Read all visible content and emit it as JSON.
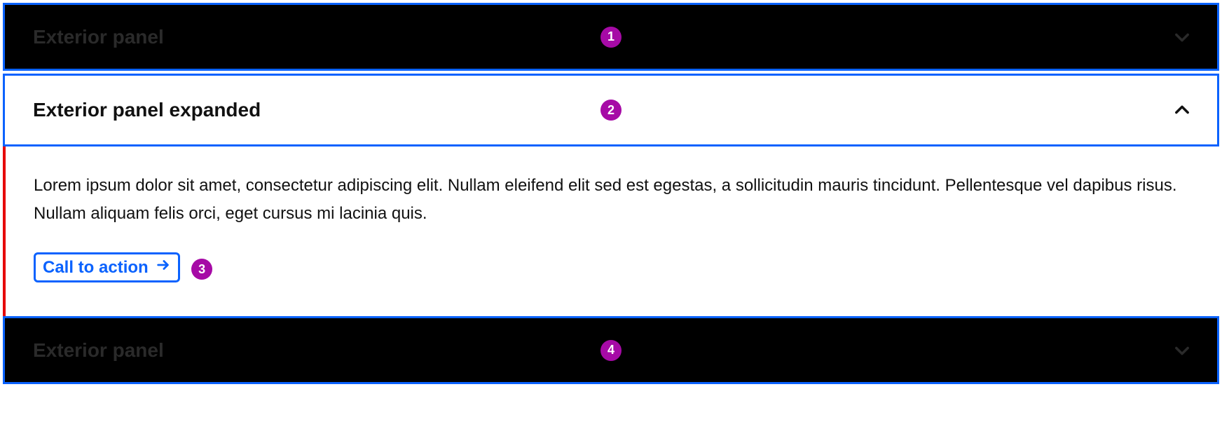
{
  "panel1": {
    "title": "Exterior panel",
    "badge": "1"
  },
  "panel2": {
    "title": "Exterior panel expanded",
    "badge": "2",
    "body": "Lorem ipsum dolor sit amet, consectetur adipiscing elit. Nullam eleifend elit sed est egestas, a sollicitudin mauris tincidunt. Pellentesque vel dapibus risus. Nullam aliquam felis orci, eget cursus mi lacinia quis.",
    "cta_label": "Call to action",
    "cta_badge": "3"
  },
  "panel3": {
    "title": "Exterior panel",
    "badge": "4"
  }
}
